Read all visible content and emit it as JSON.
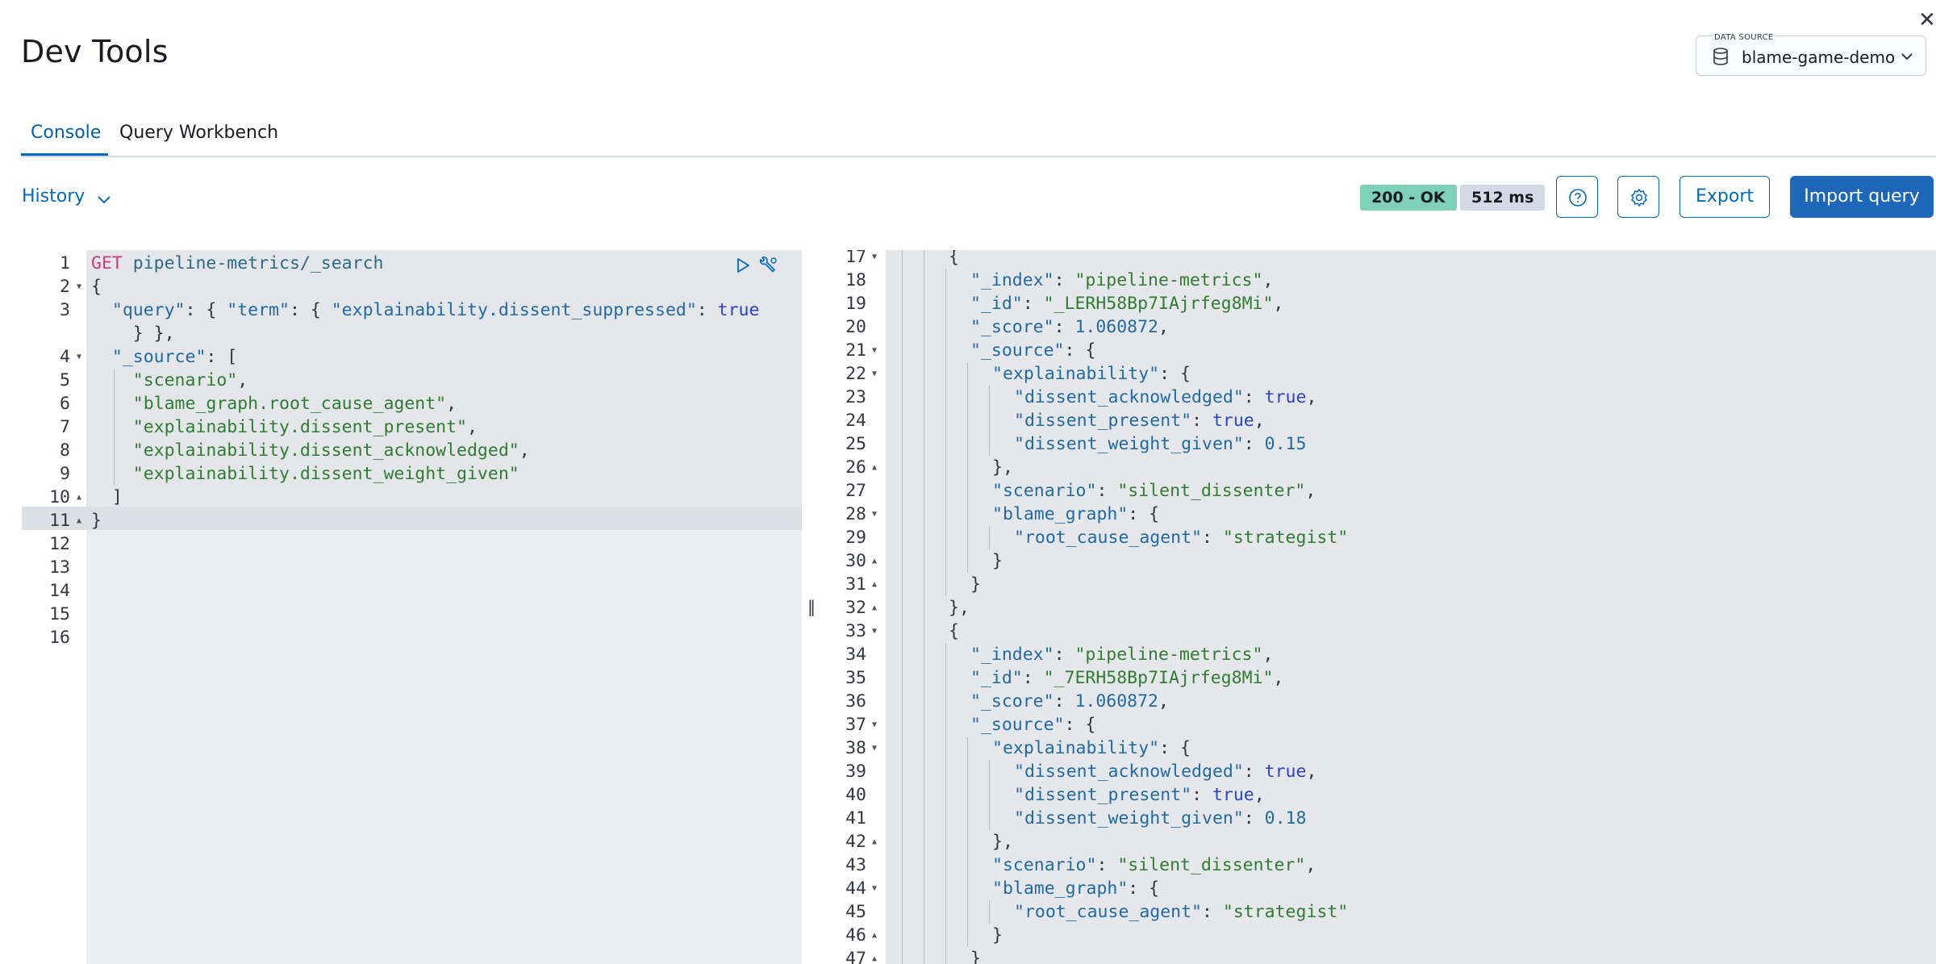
{
  "header": {
    "title": "Dev Tools",
    "close_icon": "close-icon",
    "data_source": {
      "label": "DATA SOURCE",
      "value": "blame-game-demo",
      "icon": "database-icon"
    }
  },
  "tabs": [
    {
      "label": "Console",
      "active": true
    },
    {
      "label": "Query Workbench",
      "active": false
    }
  ],
  "toolbar": {
    "history_label": "History",
    "status_badge": "200 - OK",
    "time_badge": "512 ms",
    "export_label": "Export",
    "import_label": "Import query",
    "colors": {
      "accent": "#006bb8",
      "primary": "#1e67b8",
      "status_ok": "#7dd1b6",
      "badge_gray": "#d3dae6"
    }
  },
  "request_editor": {
    "line_numbers": [
      "1",
      "2",
      "3",
      "",
      "4",
      "5",
      "6",
      "7",
      "8",
      "9",
      "10",
      "11",
      "12",
      "13",
      "14",
      "15",
      "16"
    ],
    "method": "GET",
    "url": "pipeline-metrics/_search",
    "lines": [
      [
        [
          "punc",
          "{"
        ]
      ],
      [
        [
          "punc",
          "  "
        ],
        [
          "key",
          "\"query\""
        ],
        [
          "punc",
          ": { "
        ],
        [
          "key",
          "\"term\""
        ],
        [
          "punc",
          ": { "
        ],
        [
          "key",
          "\"explainability.dissent_suppressed\""
        ],
        [
          "punc",
          ": "
        ],
        [
          "bool",
          "true"
        ]
      ],
      [
        [
          "punc",
          "    } },"
        ]
      ],
      [
        [
          "punc",
          "  "
        ],
        [
          "key",
          "\"_source\""
        ],
        [
          "punc",
          ": ["
        ]
      ],
      [
        [
          "punc",
          "    "
        ],
        [
          "str",
          "\"scenario\""
        ],
        [
          "punc",
          ","
        ]
      ],
      [
        [
          "punc",
          "    "
        ],
        [
          "str",
          "\"blame_graph.root_cause_agent\""
        ],
        [
          "punc",
          ","
        ]
      ],
      [
        [
          "punc",
          "    "
        ],
        [
          "str",
          "\"explainability.dissent_present\""
        ],
        [
          "punc",
          ","
        ]
      ],
      [
        [
          "punc",
          "    "
        ],
        [
          "str",
          "\"explainability.dissent_acknowledged\""
        ],
        [
          "punc",
          ","
        ]
      ],
      [
        [
          "punc",
          "    "
        ],
        [
          "str",
          "\"explainability.dissent_weight_given\""
        ]
      ],
      [
        [
          "punc",
          "  ]"
        ]
      ],
      [
        [
          "punc",
          "}"
        ]
      ]
    ]
  },
  "response_editor": {
    "lines": [
      {
        "n": "17",
        "f": "down",
        "i": 2,
        "t": [
          [
            "punc",
            "{"
          ]
        ]
      },
      {
        "n": "18",
        "i": 3,
        "t": [
          [
            "key",
            "\"_index\""
          ],
          [
            "punc",
            ": "
          ],
          [
            "str",
            "\"pipeline-metrics\""
          ],
          [
            "punc",
            ","
          ]
        ]
      },
      {
        "n": "19",
        "i": 3,
        "t": [
          [
            "key",
            "\"_id\""
          ],
          [
            "punc",
            ": "
          ],
          [
            "str",
            "\"_LERH58Bp7IAjrfeg8Mi\""
          ],
          [
            "punc",
            ","
          ]
        ]
      },
      {
        "n": "20",
        "i": 3,
        "t": [
          [
            "key",
            "\"_score\""
          ],
          [
            "punc",
            ": "
          ],
          [
            "num",
            "1.060872"
          ],
          [
            "punc",
            ","
          ]
        ]
      },
      {
        "n": "21",
        "f": "down",
        "i": 3,
        "t": [
          [
            "key",
            "\"_source\""
          ],
          [
            "punc",
            ": {"
          ]
        ]
      },
      {
        "n": "22",
        "f": "down",
        "i": 4,
        "t": [
          [
            "key",
            "\"explainability\""
          ],
          [
            "punc",
            ": {"
          ]
        ]
      },
      {
        "n": "23",
        "i": 5,
        "t": [
          [
            "key",
            "\"dissent_acknowledged\""
          ],
          [
            "punc",
            ": "
          ],
          [
            "bool",
            "true"
          ],
          [
            "punc",
            ","
          ]
        ]
      },
      {
        "n": "24",
        "i": 5,
        "t": [
          [
            "key",
            "\"dissent_present\""
          ],
          [
            "punc",
            ": "
          ],
          [
            "bool",
            "true"
          ],
          [
            "punc",
            ","
          ]
        ]
      },
      {
        "n": "25",
        "i": 5,
        "t": [
          [
            "key",
            "\"dissent_weight_given\""
          ],
          [
            "punc",
            ": "
          ],
          [
            "num",
            "0.15"
          ]
        ]
      },
      {
        "n": "26",
        "f": "up",
        "i": 4,
        "t": [
          [
            "punc",
            "},"
          ]
        ]
      },
      {
        "n": "27",
        "i": 4,
        "t": [
          [
            "key",
            "\"scenario\""
          ],
          [
            "punc",
            ": "
          ],
          [
            "str",
            "\"silent_dissenter\""
          ],
          [
            "punc",
            ","
          ]
        ]
      },
      {
        "n": "28",
        "f": "down",
        "i": 4,
        "t": [
          [
            "key",
            "\"blame_graph\""
          ],
          [
            "punc",
            ": {"
          ]
        ]
      },
      {
        "n": "29",
        "i": 5,
        "t": [
          [
            "key",
            "\"root_cause_agent\""
          ],
          [
            "punc",
            ": "
          ],
          [
            "str",
            "\"strategist\""
          ]
        ]
      },
      {
        "n": "30",
        "f": "up",
        "i": 4,
        "t": [
          [
            "punc",
            "}"
          ]
        ]
      },
      {
        "n": "31",
        "f": "up",
        "i": 3,
        "t": [
          [
            "punc",
            "}"
          ]
        ]
      },
      {
        "n": "32",
        "f": "up",
        "i": 2,
        "t": [
          [
            "punc",
            "},"
          ]
        ]
      },
      {
        "n": "33",
        "f": "down",
        "i": 2,
        "t": [
          [
            "punc",
            "{"
          ]
        ]
      },
      {
        "n": "34",
        "i": 3,
        "t": [
          [
            "key",
            "\"_index\""
          ],
          [
            "punc",
            ": "
          ],
          [
            "str",
            "\"pipeline-metrics\""
          ],
          [
            "punc",
            ","
          ]
        ]
      },
      {
        "n": "35",
        "i": 3,
        "t": [
          [
            "key",
            "\"_id\""
          ],
          [
            "punc",
            ": "
          ],
          [
            "str",
            "\"_7ERH58Bp7IAjrfeg8Mi\""
          ],
          [
            "punc",
            ","
          ]
        ]
      },
      {
        "n": "36",
        "i": 3,
        "t": [
          [
            "key",
            "\"_score\""
          ],
          [
            "punc",
            ": "
          ],
          [
            "num",
            "1.060872"
          ],
          [
            "punc",
            ","
          ]
        ]
      },
      {
        "n": "37",
        "f": "down",
        "i": 3,
        "t": [
          [
            "key",
            "\"_source\""
          ],
          [
            "punc",
            ": {"
          ]
        ]
      },
      {
        "n": "38",
        "f": "down",
        "i": 4,
        "t": [
          [
            "key",
            "\"explainability\""
          ],
          [
            "punc",
            ": {"
          ]
        ]
      },
      {
        "n": "39",
        "i": 5,
        "t": [
          [
            "key",
            "\"dissent_acknowledged\""
          ],
          [
            "punc",
            ": "
          ],
          [
            "bool",
            "true"
          ],
          [
            "punc",
            ","
          ]
        ]
      },
      {
        "n": "40",
        "i": 5,
        "t": [
          [
            "key",
            "\"dissent_present\""
          ],
          [
            "punc",
            ": "
          ],
          [
            "bool",
            "true"
          ],
          [
            "punc",
            ","
          ]
        ]
      },
      {
        "n": "41",
        "i": 5,
        "t": [
          [
            "key",
            "\"dissent_weight_given\""
          ],
          [
            "punc",
            ": "
          ],
          [
            "num",
            "0.18"
          ]
        ]
      },
      {
        "n": "42",
        "f": "up",
        "i": 4,
        "t": [
          [
            "punc",
            "},"
          ]
        ]
      },
      {
        "n": "43",
        "i": 4,
        "t": [
          [
            "key",
            "\"scenario\""
          ],
          [
            "punc",
            ": "
          ],
          [
            "str",
            "\"silent_dissenter\""
          ],
          [
            "punc",
            ","
          ]
        ]
      },
      {
        "n": "44",
        "f": "down",
        "i": 4,
        "t": [
          [
            "key",
            "\"blame_graph\""
          ],
          [
            "punc",
            ": {"
          ]
        ]
      },
      {
        "n": "45",
        "i": 5,
        "t": [
          [
            "key",
            "\"root_cause_agent\""
          ],
          [
            "punc",
            ": "
          ],
          [
            "str",
            "\"strategist\""
          ]
        ]
      },
      {
        "n": "46",
        "f": "up",
        "i": 4,
        "t": [
          [
            "punc",
            "}"
          ]
        ]
      },
      {
        "n": "47",
        "f": "up",
        "i": 3,
        "t": [
          [
            "punc",
            "}"
          ]
        ]
      }
    ]
  }
}
